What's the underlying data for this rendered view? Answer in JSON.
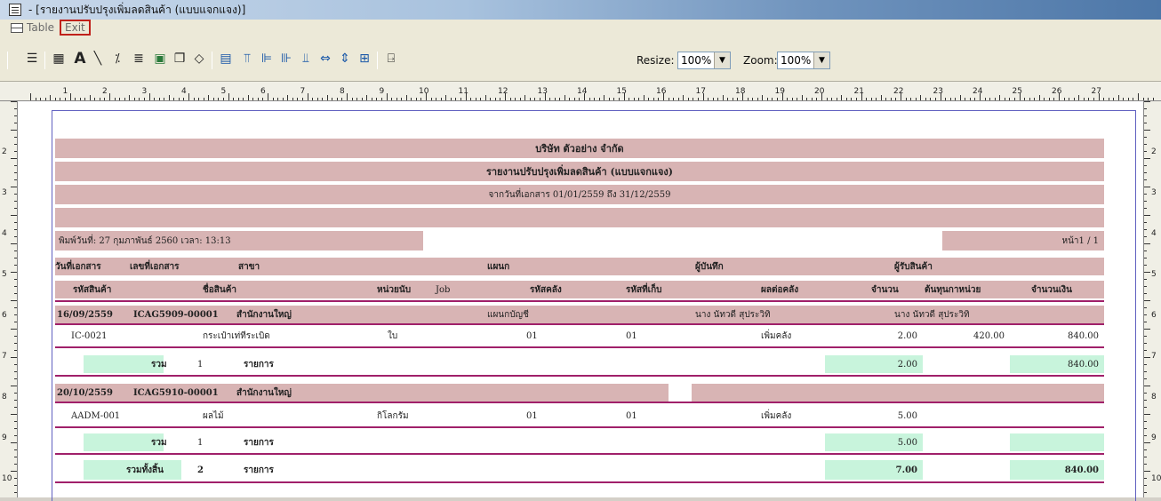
{
  "window": {
    "title": " - [รายงานปรับปรุงเพิ่มลดสินค้า (แบบแจกแจง)]"
  },
  "menu": {
    "table": "Table",
    "exit": "Exit"
  },
  "toolbar": {
    "resize_label": "Resize:",
    "resize_value": "100%",
    "zoom_label": "Zoom:",
    "zoom_value": "100%"
  },
  "ruler": {
    "top": [
      "1",
      "2",
      "3",
      "4",
      "5",
      "6",
      "7",
      "8",
      "9",
      "10",
      "11",
      "12",
      "13",
      "14",
      "15",
      "16",
      "17",
      "18",
      "19",
      "20",
      "21",
      "22",
      "23",
      "24",
      "25",
      "26",
      "27"
    ],
    "side": [
      "2",
      "3",
      "4",
      "5",
      "6",
      "7",
      "8",
      "9",
      "10"
    ]
  },
  "report": {
    "company": "บริษัท ตัวอย่าง จำกัด",
    "title": "รายงานปรับปรุงเพิ่มลดสินค้า (แบบแจกแจง)",
    "date_range": "จากวันที่เอกสาร 01/01/2559 ถึง 31/12/2559",
    "printed": "พิมพ์วันที่: 27 กุมภาพันธ์ 2560 เวลา: 13:13",
    "page": "หน้า1 / 1",
    "header1": {
      "doc_date": "วันที่เอกสาร",
      "doc_no": "เลขที่เอกสาร",
      "branch": "สาขา",
      "dept": "แผนก",
      "recorder": "ผู้บันทึก",
      "receiver": "ผู้รับสินค้า"
    },
    "header2": {
      "code": "รหัสสินค้า",
      "name": "ชื่อสินค้า",
      "unit": "หน่วยนับ",
      "job": "Job",
      "warehouse": "รหัสคลัง",
      "location": "รหัสที่เก็บ",
      "effect": "ผลต่อคลัง",
      "qty": "จำนวน",
      "unit_cost": "ต้นทุนกาหน่วย",
      "amount": "จำนวนเงิน"
    },
    "docs": [
      {
        "date": "16/09/2559",
        "no": "ICAG5909-00001",
        "branch": "สำนักงานใหญ่",
        "dept": "แผนกบัญชี",
        "recorder": "นาง นัทวดี สุประวิทิ",
        "receiver": "นาง นัทวดี สุประวิทิ",
        "item": {
          "code": "IC-0021",
          "name": "กระเป๋าเท่ทีระเบิด",
          "unit": "ใบ",
          "warehouse": "01",
          "location": "01",
          "effect": "เพิ่มคลัง",
          "qty": "2.00",
          "unit_cost": "420.00",
          "amount": "840.00"
        },
        "sum": {
          "label": "รวม",
          "count": "1",
          "unit": "รายการ",
          "qty": "2.00",
          "amount": "840.00"
        }
      },
      {
        "date": "20/10/2559",
        "no": "ICAG5910-00001",
        "branch": "สำนักงานใหญ่",
        "item": {
          "code": "AADM-001",
          "name": "ผลไม้",
          "unit": "กิโลกรัม",
          "warehouse": "01",
          "location": "01",
          "effect": "เพิ่มคลัง",
          "qty": "5.00"
        },
        "sum": {
          "label": "รวม",
          "count": "1",
          "unit": "รายการ",
          "qty": "5.00"
        }
      }
    ],
    "grand": {
      "label": "รวมทั้งสิ้น",
      "count": "2",
      "unit": "รายการ",
      "qty": "7.00",
      "amount": "840.00"
    }
  }
}
